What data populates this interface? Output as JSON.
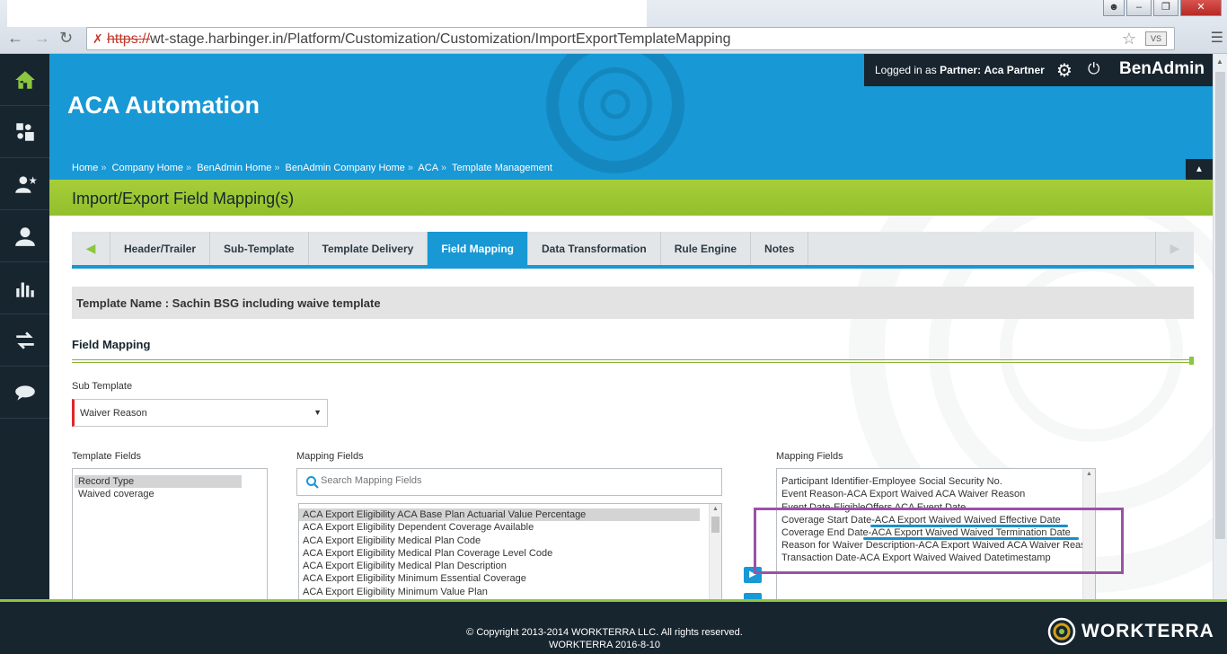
{
  "browser": {
    "url_scheme": "https://",
    "url_rest": "wt-stage.harbinger.in/Platform/Customization/Customization/ImportExportTemplateMapping",
    "ext_label": "VS"
  },
  "header": {
    "app_title": "ACA Automation",
    "logged_prefix": "Logged in as",
    "logged_role": "Partner:",
    "logged_user": "Aca Partner",
    "brand": "BenAdmin",
    "breadcrumbs": [
      "Home",
      "Company Home",
      "BenAdmin Home",
      "BenAdmin Company Home",
      "ACA",
      "Template Management"
    ],
    "breadcrumb_sep": "»"
  },
  "page_title": "Import/Export Field Mapping(s)",
  "tabs": [
    "Header/Trailer",
    "Sub-Template",
    "Template Delivery",
    "Field Mapping",
    "Data Transformation",
    "Rule Engine",
    "Notes"
  ],
  "active_tab": "Field Mapping",
  "template_name": "Template Name : Sachin BSG including waive template",
  "section_title": "Field Mapping",
  "sub_template": {
    "label": "Sub Template",
    "value": "Waiver Reason"
  },
  "template_fields": {
    "label": "Template Fields",
    "items": [
      "Record Type",
      "Waived coverage"
    ]
  },
  "mapping_fields_left": {
    "label": "Mapping Fields",
    "search_placeholder": "Search Mapping Fields",
    "items": [
      "ACA Export Eligibility ACA Base Plan Actuarial Value Percentage",
      "ACA Export Eligibility Dependent Coverage Available",
      "ACA Export Eligibility Medical Plan Code",
      "ACA Export Eligibility Medical Plan Coverage Level Code",
      "ACA Export Eligibility Medical Plan Description",
      "ACA Export Eligibility Minimum Essential Coverage",
      "ACA Export Eligibility Minimum Value Plan"
    ]
  },
  "mapping_fields_right": {
    "label": "Mapping Fields",
    "items": [
      "Participant Identifier-Employee Social Security No.",
      "Event Reason-ACA Export Waived ACA Waiver Reason",
      "Event Date-EligibleOffers ACA Event Date",
      "Coverage Start Date-ACA Export Waived Waived Effective Date",
      "Coverage End Date-ACA Export Waived Waived Termination Date",
      "Reason for Waiver Description-ACA Export Waived ACA Waiver Reason",
      "Transaction Date-ACA Export Waived Waived Datetimestamp"
    ]
  },
  "footer": {
    "copyright": "© Copyright 2013-2014 WORKTERRA LLC. All rights reserved.",
    "version": "WORKTERRA 2016-8-10",
    "logo_text": "WORKTERRA"
  },
  "colors": {
    "header_blue": "#1898d5",
    "dark_navy": "#17252f",
    "lime": "#a6ce39",
    "highlight_purple": "#9b51a8",
    "required_red": "#e0262c"
  },
  "icons": [
    "home-icon",
    "puzzle-icon",
    "user-star-icon",
    "user-icon",
    "bar-chart-icon",
    "transfer-icon",
    "chat-icon",
    "gear-icon",
    "power-icon",
    "search-icon",
    "star-icon"
  ]
}
